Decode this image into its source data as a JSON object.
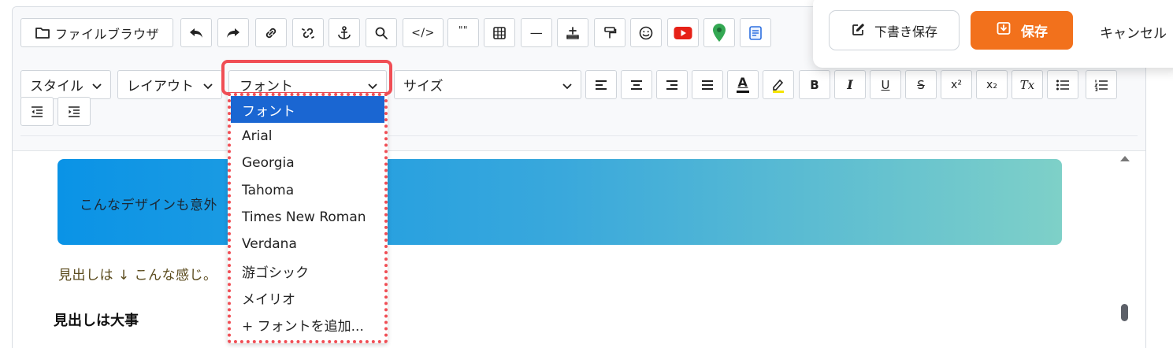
{
  "toolbar": {
    "file_browser_label": "ファイルブラウザ",
    "quote_glyph": "\"\"",
    "code_glyph": "</>",
    "hr_glyph": "—",
    "style_label": "スタイル",
    "layout_label": "レイアウト",
    "font_label": "フォント",
    "size_label": "サイズ",
    "bold_glyph": "B",
    "italic_glyph": "I",
    "underline_glyph": "U",
    "strike_glyph": "S",
    "superscript_glyph": "x²",
    "subscript_glyph": "x₂",
    "clear_format_glyph": "Tx",
    "text_color_glyph": "A"
  },
  "font_dropdown": {
    "options": [
      "フォント",
      "Arial",
      "Georgia",
      "Tahoma",
      "Times New Roman",
      "Verdana",
      "游ゴシック",
      "メイリオ",
      "+ フォントを追加..."
    ],
    "selected": "フォント"
  },
  "content": {
    "banner_text": "こんなデザインも意外",
    "paragraph": "見出しは ↓ こんな感じ。",
    "heading": "見出しは大事"
  },
  "actions": {
    "draft_label": "下書き保存",
    "save_label": "保存",
    "cancel_label": "キャンセル"
  },
  "colors": {
    "accent_orange": "#f2711c",
    "highlight_red": "#f04e55",
    "selected_blue": "#1a66d2",
    "youtube_red": "#e62117",
    "map_green": "#34a853"
  }
}
